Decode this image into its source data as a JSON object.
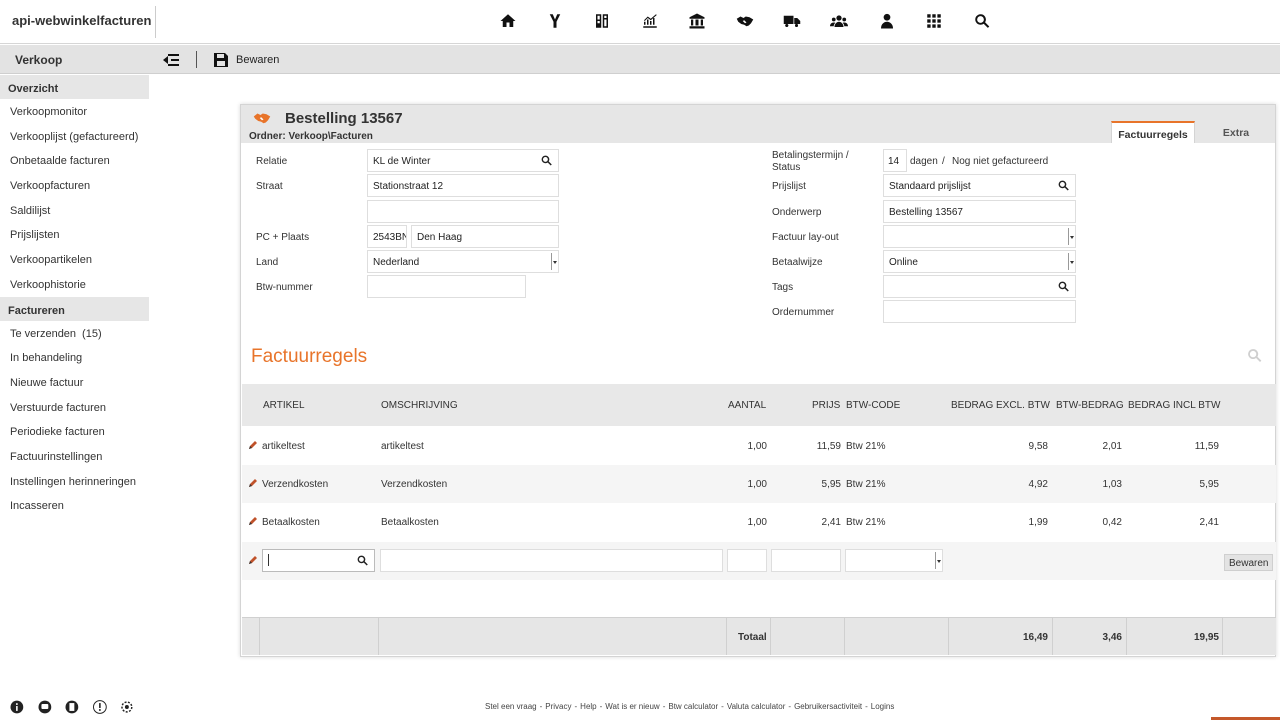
{
  "app": {
    "title": "api-webwinkelfacturen"
  },
  "topnav": [
    {
      "icon": "home-icon"
    },
    {
      "icon": "y-logo-icon"
    },
    {
      "icon": "dashboard-icon"
    },
    {
      "icon": "chart-line-icon"
    },
    {
      "icon": "bank-icon"
    },
    {
      "icon": "handshake-icon"
    },
    {
      "icon": "truck-icon"
    },
    {
      "icon": "users-icon"
    },
    {
      "icon": "user-icon"
    },
    {
      "icon": "apps-grid-icon"
    },
    {
      "icon": "search-icon"
    }
  ],
  "toolbar": {
    "section": "Verkoop",
    "save_label": "Bewaren"
  },
  "sidebar": {
    "group1": "Overzicht",
    "group1_items": [
      "Verkoopmonitor",
      "Verkooplijst (gefactureerd)",
      "Onbetaalde facturen",
      "Verkoopfacturen",
      "Saldilijst",
      "Prijslijsten",
      "Verkoopartikelen",
      "Verkoophistorie"
    ],
    "group2": "Factureren",
    "group2_items": [
      "Te verzenden",
      "In behandeling",
      "Nieuwe factuur",
      "Verstuurde facturen",
      "Periodieke facturen",
      "Factuurinstellingen",
      "Instellingen herinneringen",
      "Incasseren"
    ],
    "te_verzenden_count": "(15)"
  },
  "order": {
    "title": "Bestelling 13567",
    "path": "Ordner: Verkoop\\Facturen",
    "tabs": [
      "Factuurregels",
      "Extra"
    ]
  },
  "form": {
    "relatie_label": "Relatie",
    "relatie": "KL de Winter",
    "straat_label": "Straat",
    "straat": "Stationstraat 12",
    "pcplaats_label": "PC + Plaats",
    "pc": "2543BN",
    "plaats": "Den Haag",
    "land_label": "Land",
    "land": "Nederland",
    "btw_label": "Btw-nummer",
    "btw": "",
    "betaaltermijn_label": "Betalingstermijn  /",
    "status_label": "Status",
    "termijn": "14",
    "dagen": "dagen",
    "slash": "/",
    "status": "Nog niet gefactureerd",
    "prijslijst_label": "Prijslijst",
    "prijslijst": "Standaard prijslijst",
    "onderwerp_label": "Onderwerp",
    "onderwerp": "Bestelling 13567",
    "layout_label": "Factuur lay-out",
    "layout": "",
    "betaalwijze_label": "Betaalwijze",
    "betaalwijze": "Online",
    "tags_label": "Tags",
    "tags": "",
    "ordernummer_label": "Ordernummer",
    "ordernummer": ""
  },
  "lines": {
    "heading": "Factuurregels",
    "headers": [
      "ARTIKEL",
      "OMSCHRIJVING",
      "AANTAL",
      "PRIJS",
      "BTW-CODE",
      "BEDRAG EXCL. BTW",
      "BTW-BEDRAG",
      "BEDRAG INCL BTW"
    ],
    "rows": [
      {
        "artikel": "artikeltest",
        "omschrijving": "artikeltest",
        "aantal": "1,00",
        "prijs": "11,59",
        "btwcode": "Btw 21%",
        "excl": "9,58",
        "btw": "2,01",
        "incl": "11,59"
      },
      {
        "artikel": "Verzendkosten",
        "omschrijving": "Verzendkosten",
        "aantal": "1,00",
        "prijs": "5,95",
        "btwcode": "Btw 21%",
        "excl": "4,92",
        "btw": "1,03",
        "incl": "5,95"
      },
      {
        "artikel": "Betaalkosten",
        "omschrijving": "Betaalkosten",
        "aantal": "1,00",
        "prijs": "2,41",
        "btwcode": "Btw 21%",
        "excl": "1,99",
        "btw": "0,42",
        "incl": "2,41"
      }
    ],
    "new_save_label": "Bewaren",
    "total_label": "Totaal",
    "total_excl": "16,49",
    "total_btw": "3,46",
    "total_incl": "19,95"
  },
  "footer": {
    "links": [
      "Stel een vraag",
      "Privacy",
      "Help",
      "Wat is er nieuw",
      "Btw calculator",
      "Valuta calculator",
      "Gebruikersactiviteit",
      "Logins"
    ],
    "icons": [
      "info-icon",
      "chat-icon",
      "document-icon",
      "alert-icon",
      "settings-icon"
    ]
  },
  "colors": {
    "accent": "#e8742a",
    "header_bg": "#e6e6e6"
  }
}
